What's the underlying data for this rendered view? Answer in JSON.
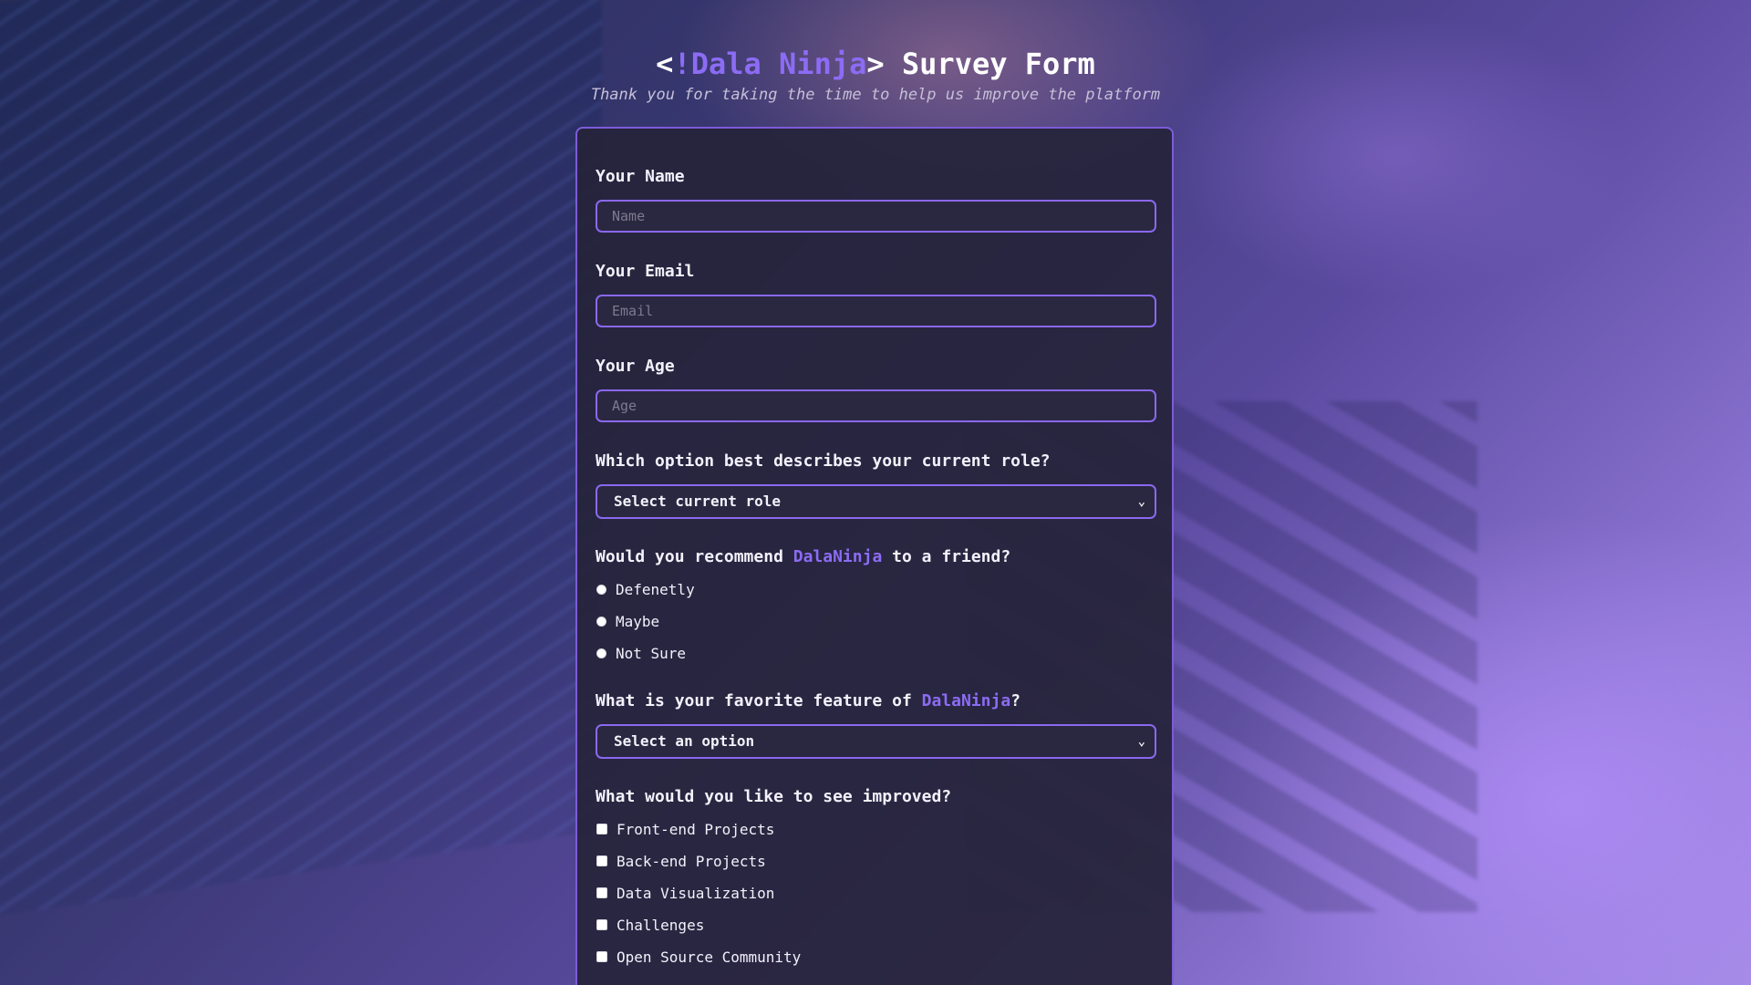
{
  "header": {
    "title_open": "<",
    "title_brand": "!Dala Ninja",
    "title_close": ">",
    "title_rest": " Survey Form",
    "subtitle": "Thank you for taking the time to help us improve the platform"
  },
  "form": {
    "name": {
      "label": "Your Name",
      "placeholder": "Name",
      "value": ""
    },
    "email": {
      "label": "Your Email",
      "placeholder": "Email",
      "value": ""
    },
    "age": {
      "label": "Your Age",
      "placeholder": "Age",
      "value": ""
    },
    "role": {
      "label": "Which option best describes your current role?",
      "selected": "Select current role"
    },
    "recommend": {
      "label_before": "Would you recommend ",
      "label_brand": "DalaNinja",
      "label_after": " to a friend?",
      "options": [
        "Defenetly",
        "Maybe",
        "Not Sure"
      ]
    },
    "feature": {
      "label_before": "What is your favorite feature of ",
      "label_brand": "DalaNinja",
      "label_after": "?",
      "selected": "Select an option"
    },
    "improve": {
      "label": "What would you like to see improved?",
      "options": [
        "Front-end Projects",
        "Back-end Projects",
        "Data Visualization",
        "Challenges",
        "Open Source Community"
      ]
    }
  },
  "colors": {
    "accent": "#8c6cf4",
    "border": "#8a68f0",
    "panel": "#26243a"
  }
}
